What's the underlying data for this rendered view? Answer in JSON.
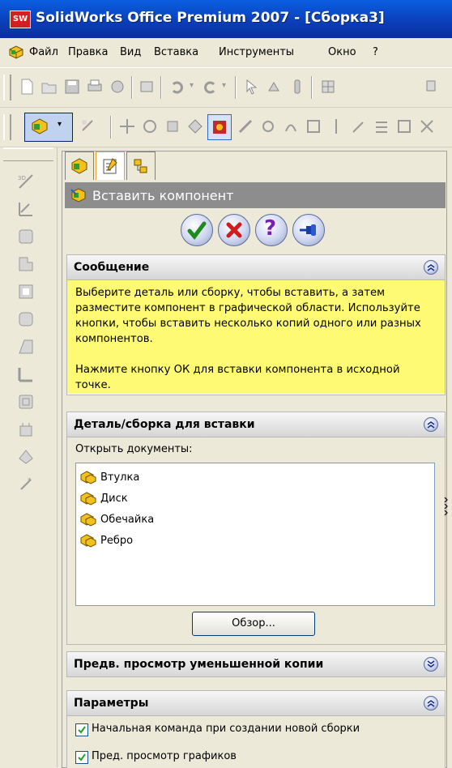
{
  "app": {
    "title": "SolidWorks Office Premium 2007 - [Сборка3]",
    "logo_text": "SW"
  },
  "menu": {
    "items": [
      "Файл",
      "Правка",
      "Вид",
      "Вставка",
      "Инструменты",
      "Окно",
      "?"
    ]
  },
  "property_manager": {
    "title": "Вставить компонент",
    "actions": {
      "ok_icon": "green-check-icon",
      "cancel_icon": "red-x-icon",
      "help_icon": "question-icon",
      "pin_icon": "pushpin-icon"
    },
    "message_section": {
      "title": "Сообщение",
      "text": "Выберите деталь или сборку, чтобы вставить, а затем разместите компонент в графической области. Используйте кнопки, чтобы вставить несколько копий одного или разных компонентов.\n\nНажмите кнопку ОК для вставки компонента в исходной точке."
    },
    "part_section": {
      "title": "Деталь/сборка для вставки",
      "open_docs_label": "Открыть документы:",
      "documents": [
        "Втулка",
        "Диск",
        "Обечайка",
        "Ребро"
      ],
      "browse_label": "Обзор..."
    },
    "preview_section": {
      "title": "Предв. просмотр уменьшенной копии"
    },
    "options_section": {
      "title": "Параметры",
      "options": [
        {
          "label": "Начальная команда при создании новой сборки",
          "checked": true
        },
        {
          "label": "Пред. просмотр графиков",
          "checked": true
        }
      ]
    }
  },
  "colors": {
    "title_bar": "#0b3db8",
    "message_bg": "#fffa73",
    "header_gray": "#8d8d8d"
  }
}
